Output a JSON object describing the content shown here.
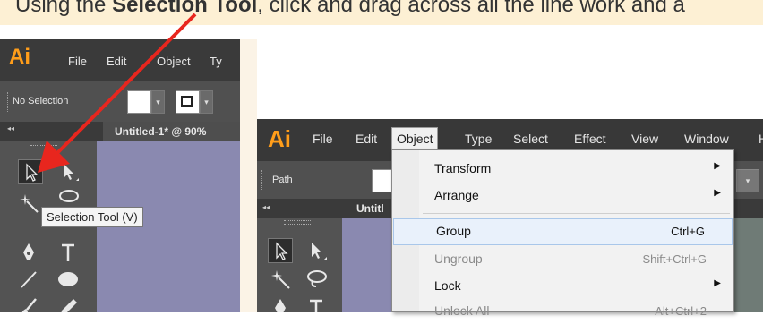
{
  "banner": {
    "text_prefix": "Using the ",
    "text_bold": "Selection Tool",
    "text_suffix": ", click and drag across all the line work and a"
  },
  "left_screenshot": {
    "app_logo": "Ai",
    "menus": [
      "File",
      "Edit",
      "Object",
      "Ty"
    ],
    "control_label": "No Selection",
    "doc_tab": "Untitled-1* @ 90%",
    "collapse_glyph": "◂◂",
    "tooltip": "Selection Tool (V)"
  },
  "right_screenshot": {
    "app_logo": "Ai",
    "menus": [
      "File",
      "Edit",
      "Object",
      "Type",
      "Select",
      "Effect",
      "View",
      "Window",
      "H"
    ],
    "control_label": "Path",
    "doc_tab": "Untitl",
    "collapse_glyph": "◂◂",
    "object_menu": [
      {
        "label": "Transform",
        "shortcut": "",
        "submenu": true,
        "disabled": false
      },
      {
        "label": "Arrange",
        "shortcut": "",
        "submenu": true,
        "disabled": false
      },
      {
        "label": "Group",
        "shortcut": "Ctrl+G",
        "submenu": false,
        "disabled": false,
        "highlighted": true
      },
      {
        "label": "Ungroup",
        "shortcut": "Shift+Ctrl+G",
        "submenu": false,
        "disabled": true
      },
      {
        "label": "Lock",
        "shortcut": "",
        "submenu": true,
        "disabled": false
      },
      {
        "label": "Unlock All",
        "shortcut": "Alt+Ctrl+2",
        "submenu": false,
        "disabled": true
      }
    ]
  },
  "colors": {
    "accent_orange": "#ff9d1a",
    "arrow_red": "#e8261e",
    "canvas_blue": "#8a89b0",
    "banner_bg": "#fdf0d4"
  }
}
